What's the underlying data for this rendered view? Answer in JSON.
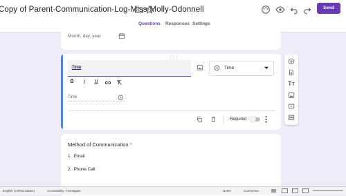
{
  "header": {
    "doc_title": "Copy of Parent-Communication-Log-Miss-Molly-Odonnell",
    "send_label": "Send"
  },
  "tabs": [
    {
      "label": "Questions",
      "active": true
    },
    {
      "label": "Responses",
      "active": false
    },
    {
      "label": "Settings",
      "active": false
    }
  ],
  "date_card": {
    "placeholder": "Month, day, year"
  },
  "question_card": {
    "question_text": "Time",
    "type_label": "Time",
    "answer_placeholder": "Time",
    "required_label": "Required",
    "required_on": false,
    "format_buttons": [
      "B",
      "I",
      "U",
      "link",
      "clear"
    ]
  },
  "choice_card": {
    "title": "Method of Communication",
    "required_star": "*",
    "options": [
      {
        "num": "1.",
        "label": "Email"
      },
      {
        "num": "2.",
        "label": "Phone Call"
      }
    ]
  },
  "side_toolbar": [
    "add-question",
    "import-questions",
    "add-title",
    "add-image",
    "add-video",
    "add-section"
  ],
  "statusbar": {
    "language": "English (United States)",
    "accessibility": "Accessibility: Investigate",
    "notes": "Notes",
    "comments": "Comments"
  },
  "colors": {
    "accent": "#673ab7",
    "active_card": "#4285f4",
    "required": "#d93025"
  }
}
